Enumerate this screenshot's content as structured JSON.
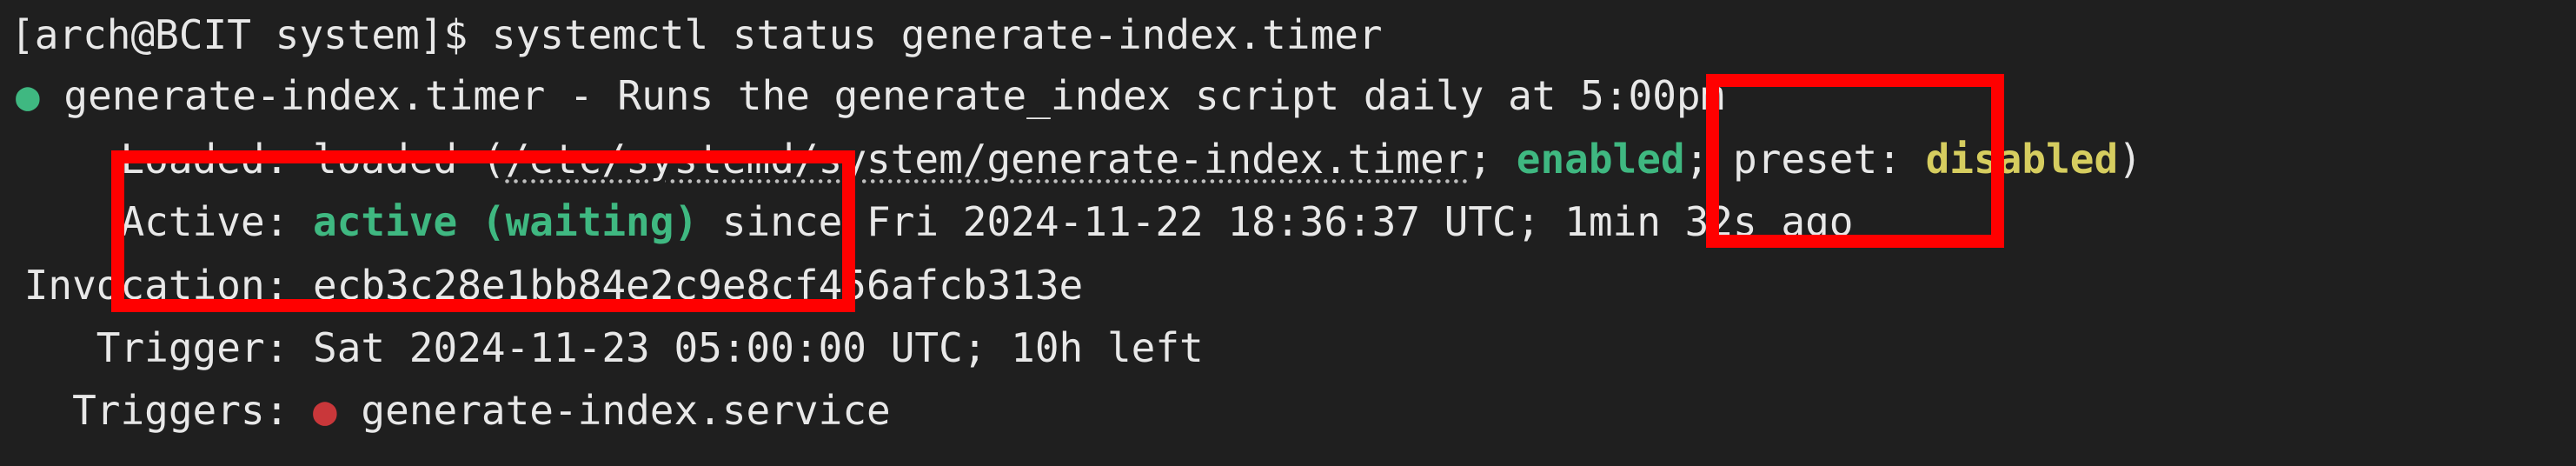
{
  "terminal": {
    "prompt": "[arch@BCIT system]$ ",
    "command": "systemctl status generate-index.timer",
    "status_bullet": "●",
    "unit_line": "generate-index.timer - Runs the generate_index script daily at 5:00pm",
    "loaded_label": "     Loaded: ",
    "loaded_value_prefix": "loaded (",
    "loaded_path": "/etc/systemd/system/generate-index.timer",
    "loaded_sep": "; ",
    "enabled_text": "enabled",
    "preset_prefix": "; preset: ",
    "preset_value": "disabled",
    "loaded_suffix": ")",
    "active_label": "     Active: ",
    "active_value": "active (waiting)",
    "active_since": " since Fri 2024-11-22 18:36:37 UTC; 1min 32s ago",
    "invocation_label": " Invocation: ",
    "invocation_value": "ecb3c28e1bb84e2c9e8cf456afcb313e",
    "trigger_label": "    Trigger: ",
    "trigger_value": "Sat 2024-11-23 05:00:00 UTC; 10h left",
    "triggers_label": "   Triggers: ",
    "triggers_bullet": "●",
    "triggers_value": " generate-index.service"
  },
  "colors": {
    "background": "#1f1f1f",
    "text": "#e8e8e8",
    "green": "#3fb881",
    "yellow": "#d6cd5f",
    "red_bullet": "#c9373a",
    "highlight": "#ff0000"
  }
}
